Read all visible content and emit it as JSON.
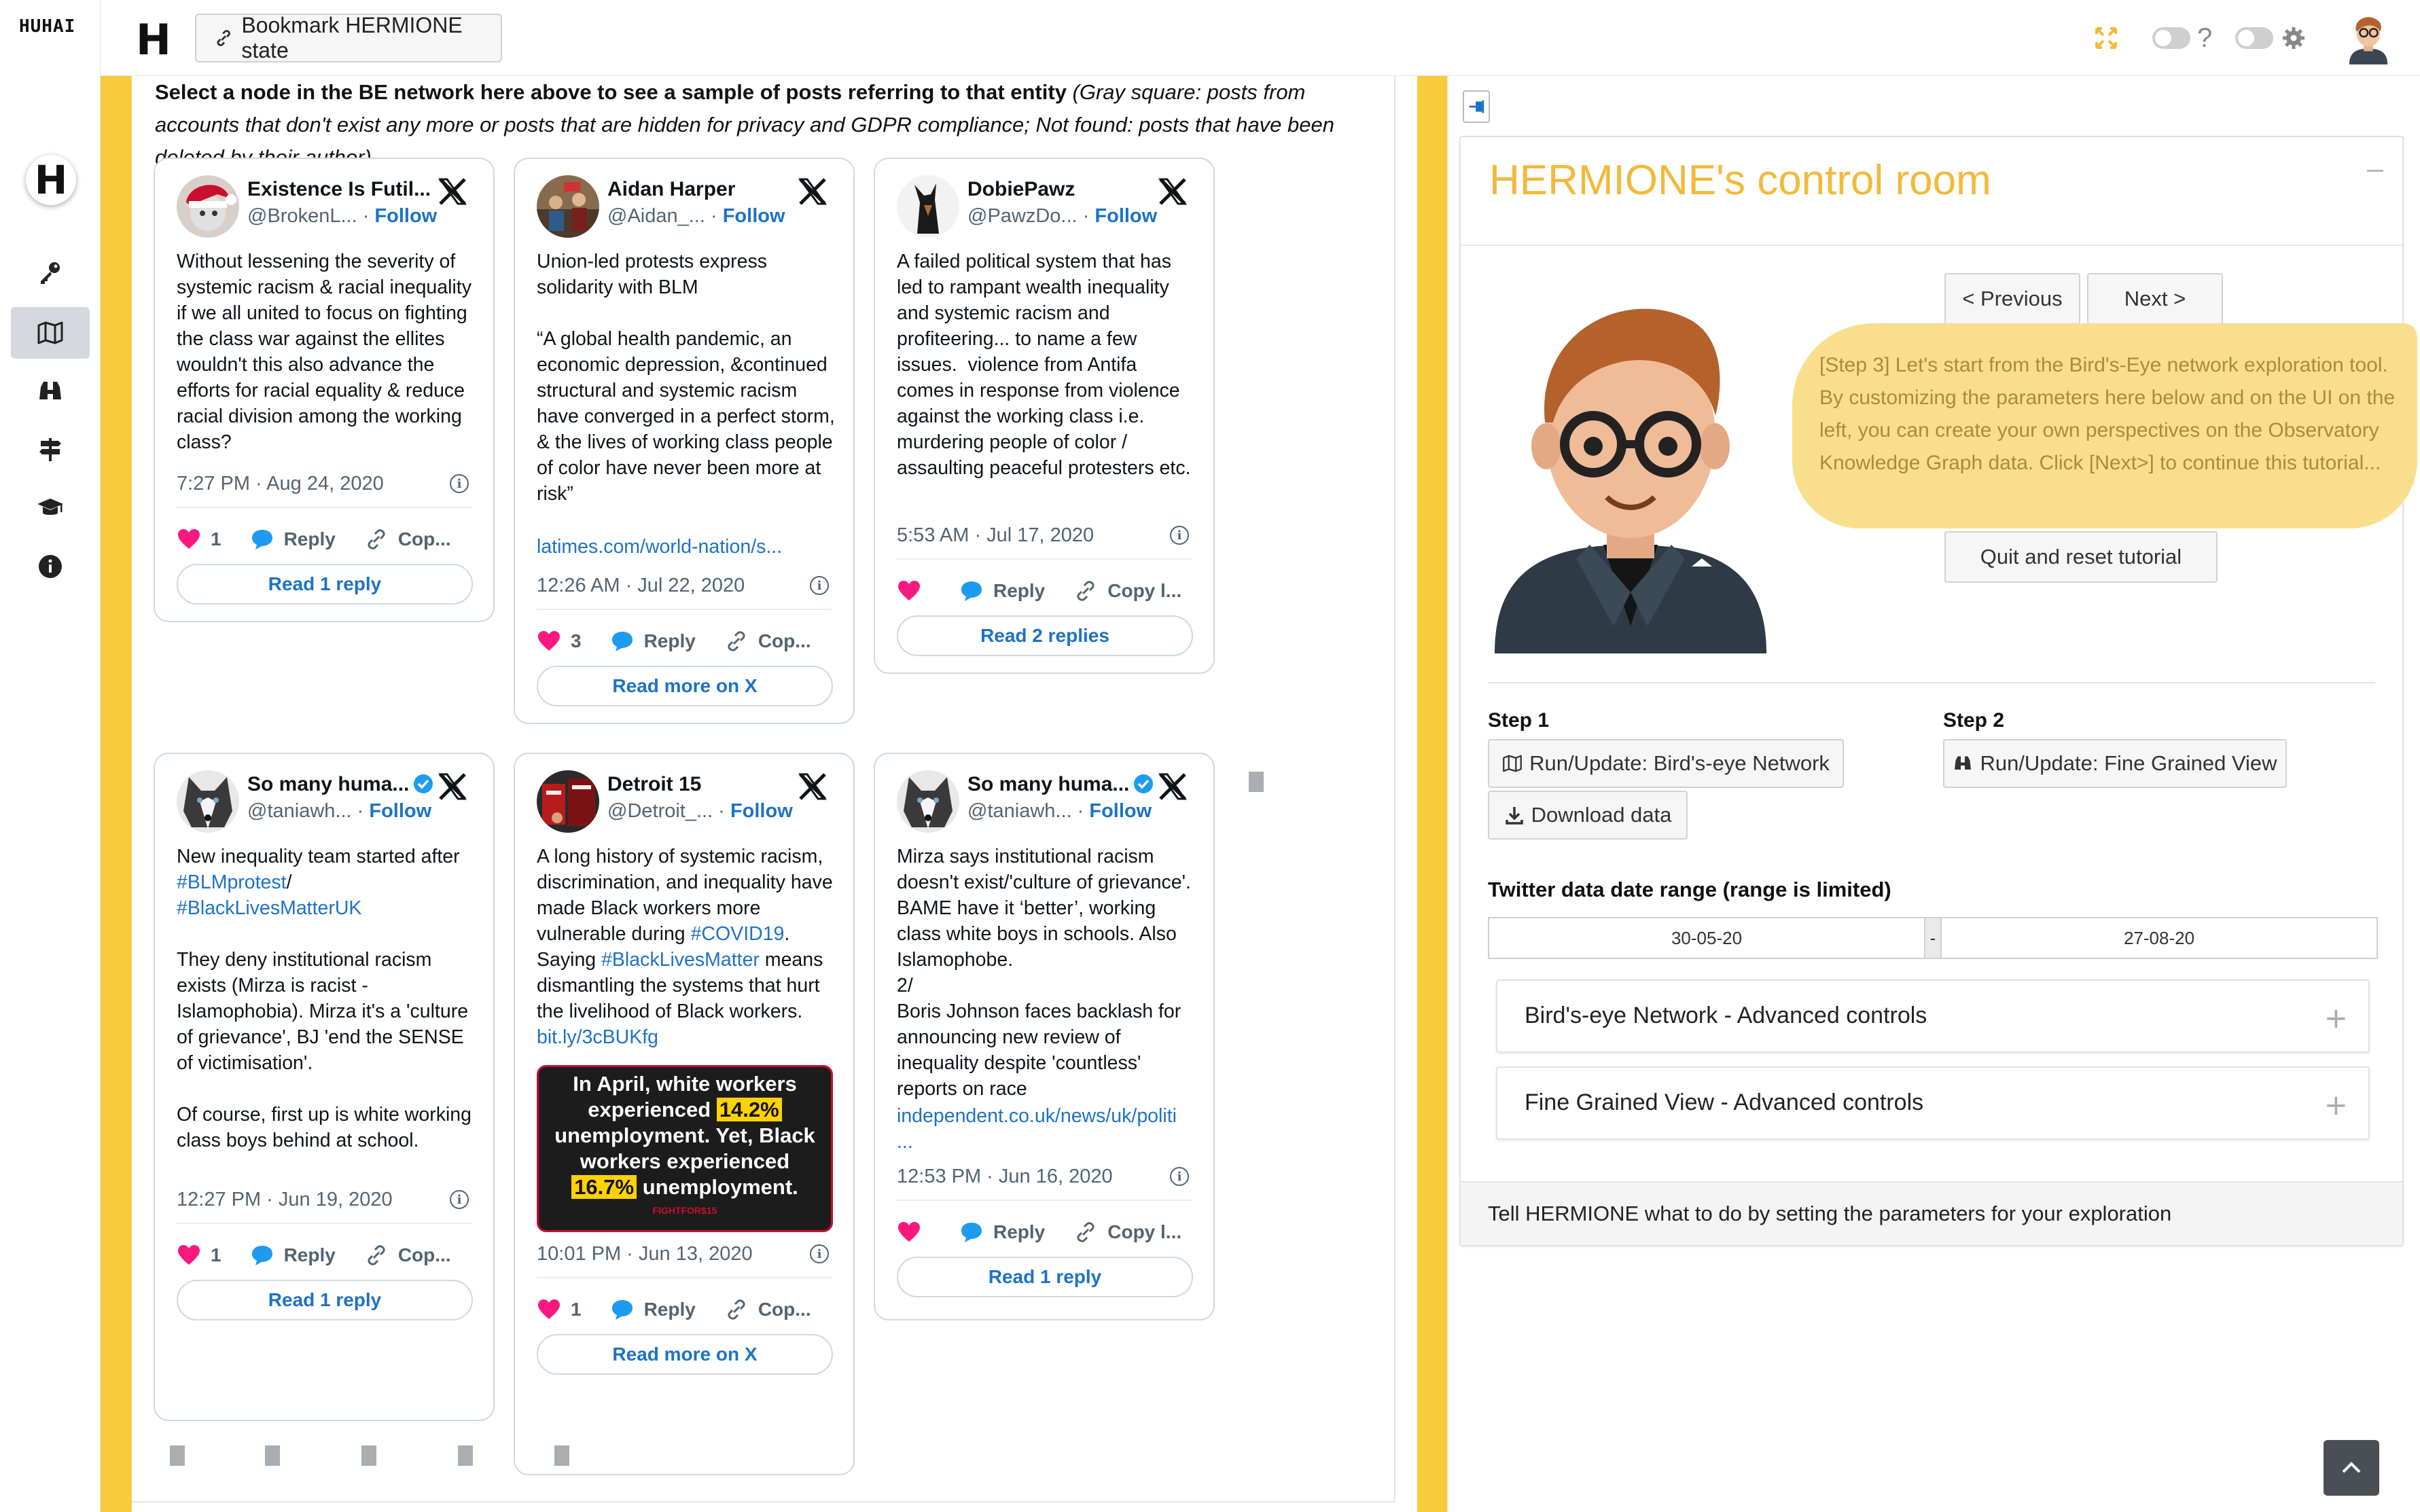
{
  "app": {
    "wordmark": "HUHAI",
    "logo_letter": "H",
    "bookmark_label": "Bookmark HERMIONE state",
    "help_glyph": "?"
  },
  "rail": {
    "items": [
      {
        "icon": "key-icon",
        "active": false
      },
      {
        "icon": "map-icon",
        "active": true
      },
      {
        "icon": "binoculars-icon",
        "active": false
      },
      {
        "icon": "signpost-icon",
        "active": false
      },
      {
        "icon": "graduation-cap-icon",
        "active": false
      },
      {
        "icon": "info-icon",
        "active": false
      }
    ]
  },
  "colors": {
    "accent_yellow": "#f7cb3d",
    "title_gold": "#f2b93a",
    "link_blue": "#1d72c7",
    "like_pink": "#f91880",
    "reply_blue": "#1d9bf0"
  },
  "feed": {
    "intro_bold": "Select a node in the BE network here above to see a sample of posts referring to that entity",
    "intro_italic": " (Gray square: posts from accounts that don't exist any more or posts that are hidden for privacy and GDPR compliance; Not found: posts that have been deleted by their author)",
    "tweets": [
      {
        "name": "Existence Is Futil...",
        "handle": "@BrokenL...",
        "follow": "Follow",
        "verified": false,
        "body": "Without lessening the severity of systemic racism & racial inequality if we all united to focus on fighting the class war against the ellites wouldn't this also advance the efforts for racial equality & reduce racial division among the working class?",
        "time": "7:27 PM · Aug 24, 2020",
        "likes": "1",
        "reply_label": "Reply",
        "copy_label": "Cop...",
        "pill": "Read 1 reply"
      },
      {
        "name": "Aidan Harper",
        "handle": "@Aidan_...",
        "follow": "Follow",
        "verified": false,
        "body": "Union-led protests express solidarity with BLM\n\n“A global health pandemic, an economic depression, &continued structural and systemic racism have converged in a perfect storm, & the lives of working class people of color have never been more at risk”",
        "link": "latimes.com/world-nation/s...",
        "time": "12:26 AM · Jul 22, 2020",
        "likes": "3",
        "reply_label": "Reply",
        "copy_label": "Cop...",
        "pill": "Read more on X"
      },
      {
        "name": "DobiePawz",
        "handle": "@PawzDo...",
        "follow": "Follow",
        "verified": false,
        "body": "A failed political system that has led to rampant wealth inequality and systemic racism and profiteering... to name a few issues.  violence from Antifa comes in response from violence against the working class i.e. murdering people of color / assaulting peaceful protesters etc.",
        "time": "5:53 AM · Jul 17, 2020",
        "likes": "",
        "reply_label": "Reply",
        "copy_label": "Copy l...",
        "pill": "Read 2 replies"
      },
      {
        "name": "So many huma...",
        "handle": "@taniawh...",
        "follow": "Follow",
        "verified": true,
        "body_pre": "New inequality team started after ",
        "tag1": "#BLMprotest",
        "mid": "/",
        "tag2": "#BlackLivesMatterUK",
        "body_post": "They deny institutional racism exists (Mirza is racist - Islamophobia). Mirza it's a 'culture of grievance', BJ 'end the SENSE of victimisation'.\n\nOf course, first up is white working class boys behind at school.",
        "time": "12:27 PM · Jun 19, 2020",
        "likes": "1",
        "reply_label": "Reply",
        "copy_label": "Cop...",
        "pill": "Read 1 reply"
      },
      {
        "name": "Detroit 15",
        "handle": "@Detroit_...",
        "follow": "Follow",
        "verified": false,
        "body_a": "A long history of systemic racism, discrimination, and inequality have made Black workers more vulnerable during ",
        "tag1": "#COVID19",
        "body_b": ". Saying ",
        "tag2": "#BlackLivesMatter",
        "body_c": " means dismantling the systems that hurt the livelihood of Black workers.",
        "link": "bit.ly/3cBUKfg",
        "image": {
          "line1": "In April, white workers",
          "line2a": "experienced ",
          "hl1": "14.2%",
          "line3": "unemployment. Yet, Black",
          "line4": "workers experienced",
          "hl2": "16.7%",
          "line5": " unemployment.",
          "brand": "FIGHTFOR$15"
        },
        "time": "10:01 PM · Jun 13, 2020",
        "likes": "1",
        "reply_label": "Reply",
        "copy_label": "Cop...",
        "pill": "Read more on X"
      },
      {
        "name": "So many huma...",
        "handle": "@taniawh...",
        "follow": "Follow",
        "verified": true,
        "body": "Mirza says institutional racism doesn't exist/'culture of grievance'. BAME have it ‘better’, working class white boys in schools. Also Islamophobe.\n2/\nBoris Johnson faces backlash for announcing new review of inequality despite 'countless' reports on race",
        "link": "independent.co.uk/news/uk/politi\n...",
        "time": "12:53 PM · Jun 16, 2020",
        "likes": "",
        "reply_label": "Reply",
        "copy_label": "Copy l...",
        "pill": "Read 1 reply"
      }
    ]
  },
  "control_room": {
    "title": "HERMIONE's control room",
    "prev_label": "< Previous",
    "next_label": "Next >",
    "tutorial_text": "[Step 3] Let's start from the Bird's-Eye network exploration tool. By customizing the parameters here below and on the UI on the left, you can create your own perspectives on the Observatory Knowledge Graph data. Click [Next>] to continue this tutorial...",
    "quit_label": "Quit and reset tutorial",
    "step1_label": "Step 1",
    "step2_label": "Step 2",
    "run_be_label": "Run/Update: Bird's-eye Network",
    "run_fg_label": "Run/Update: Fine Grained View",
    "download_label": "Download data",
    "date_range_label": "Twitter data date range (range is limited)",
    "date_from": "30-05-20",
    "date_sep": "-",
    "date_to": "27-08-20",
    "accordion": [
      {
        "label": "Bird's-eye Network - Advanced controls",
        "toggle": "+"
      },
      {
        "label": "Fine Grained View - Advanced controls",
        "toggle": "+"
      }
    ],
    "footer": "Tell HERMIONE what to do by setting the parameters for your exploration"
  }
}
